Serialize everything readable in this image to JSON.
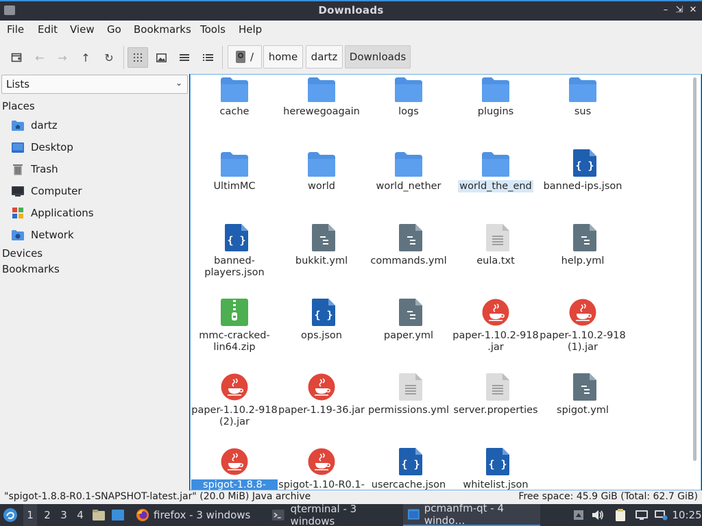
{
  "window": {
    "title": "Downloads"
  },
  "menu": [
    "File",
    "Edit",
    "View",
    "Go",
    "Bookmarks",
    "Tools",
    "Help"
  ],
  "path": {
    "root": "/",
    "segments": [
      "home",
      "dartz",
      "Downloads"
    ]
  },
  "left_pane": {
    "view_select": "Lists",
    "places_heading": "Places",
    "places": [
      {
        "label": "dartz",
        "icon": "home-folder-icon"
      },
      {
        "label": "Desktop",
        "icon": "desktop-icon"
      },
      {
        "label": "Trash",
        "icon": "trash-icon"
      },
      {
        "label": "Computer",
        "icon": "computer-icon"
      },
      {
        "label": "Applications",
        "icon": "applications-icon"
      },
      {
        "label": "Network",
        "icon": "network-icon"
      }
    ],
    "devices_heading": "Devices",
    "bookmarks_heading": "Bookmarks"
  },
  "files": [
    {
      "name": "cache",
      "type": "folder"
    },
    {
      "name": "herewegoagain",
      "type": "folder"
    },
    {
      "name": "logs",
      "type": "folder"
    },
    {
      "name": "plugins",
      "type": "folder"
    },
    {
      "name": "sus",
      "type": "folder"
    },
    {
      "name": "UltimMC",
      "type": "folder"
    },
    {
      "name": "world",
      "type": "folder"
    },
    {
      "name": "world_nether",
      "type": "folder"
    },
    {
      "name": "world_the_end",
      "type": "folder",
      "highlighted": true
    },
    {
      "name": "banned-ips.json",
      "type": "json"
    },
    {
      "name": "banned-\nplayers.json",
      "type": "json"
    },
    {
      "name": "bukkit.yml",
      "type": "yml"
    },
    {
      "name": "commands.yml",
      "type": "yml"
    },
    {
      "name": "eula.txt",
      "type": "text"
    },
    {
      "name": "help.yml",
      "type": "yml"
    },
    {
      "name": "mmc-cracked-\nlin64.zip",
      "type": "zip"
    },
    {
      "name": "ops.json",
      "type": "json"
    },
    {
      "name": "paper.yml",
      "type": "yml"
    },
    {
      "name": "paper-1.10.2-918\n.jar",
      "type": "jar"
    },
    {
      "name": "paper-1.10.2-918\n(1).jar",
      "type": "jar"
    },
    {
      "name": "paper-1.10.2-918\n(2).jar",
      "type": "jar"
    },
    {
      "name": "paper-1.19-36.jar",
      "type": "jar"
    },
    {
      "name": "permissions.yml",
      "type": "text"
    },
    {
      "name": "server.properties",
      "type": "text"
    },
    {
      "name": "spigot.yml",
      "type": "yml"
    },
    {
      "name": "spigot-1.8.8-",
      "type": "jar",
      "selected": true
    },
    {
      "name": "spigot-1.10-R0.1-",
      "type": "jar"
    },
    {
      "name": "usercache.json",
      "type": "json"
    },
    {
      "name": "whitelist.json",
      "type": "json"
    }
  ],
  "status": {
    "selection": "\"spigot-1.8.8-R0.1-SNAPSHOT-latest.jar\" (20.0 MiB) Java archive",
    "free_space": "Free space: 45.9 GiB (Total: 62.7 GiB)"
  },
  "taskbar": {
    "workspaces": [
      "1",
      "2",
      "3",
      "4"
    ],
    "tasks": [
      {
        "label": "firefox - 3 windows",
        "icon": "firefox-icon"
      },
      {
        "label": "qterminal - 3 windows",
        "icon": "terminal-icon"
      },
      {
        "label": "pcmanfm-qt - 4 windo…",
        "icon": "file-manager-icon",
        "active": true
      }
    ],
    "clock": "10:25"
  },
  "colors": {
    "folder": "#4f92e3",
    "json": "#1f5fb0",
    "yml": "#607480",
    "text": "#dcdcdc",
    "zip": "#4caf50",
    "jar": "#e0463a",
    "selection": "#3d8ee0",
    "accent": "#3b8ed8"
  }
}
